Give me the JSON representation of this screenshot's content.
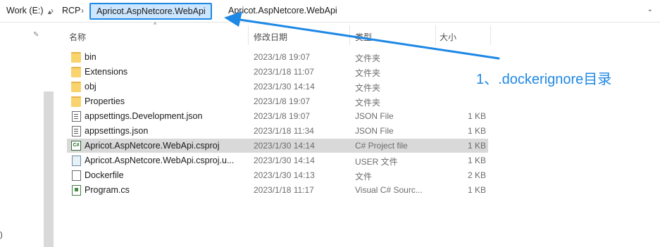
{
  "breadcrumb": {
    "items": [
      "Work (E:)",
      "RCP",
      "Apricot.AspNetcore.WebApi",
      "Apricot.AspNetcore.WebApi"
    ]
  },
  "columns": {
    "name": "名称",
    "date": "修改日期",
    "type": "类型",
    "size": "大小"
  },
  "files": [
    {
      "name": "bin",
      "date": "2023/1/8 19:07",
      "type": "文件夹",
      "size": "",
      "icon": "folder-icon"
    },
    {
      "name": "Extensions",
      "date": "2023/1/18 11:07",
      "type": "文件夹",
      "size": "",
      "icon": "folder-icon"
    },
    {
      "name": "obj",
      "date": "2023/1/30 14:14",
      "type": "文件夹",
      "size": "",
      "icon": "folder-icon"
    },
    {
      "name": "Properties",
      "date": "2023/1/8 19:07",
      "type": "文件夹",
      "size": "",
      "icon": "folder-icon"
    },
    {
      "name": "appsettings.Development.json",
      "date": "2023/1/8 19:07",
      "type": "JSON File",
      "size": "1 KB",
      "icon": "json-file-icon"
    },
    {
      "name": "appsettings.json",
      "date": "2023/1/18 11:34",
      "type": "JSON File",
      "size": "1 KB",
      "icon": "json-file-icon"
    },
    {
      "name": "Apricot.AspNetcore.WebApi.csproj",
      "date": "2023/1/30 14:14",
      "type": "C# Project file",
      "size": "1 KB",
      "icon": "csproj-file-icon",
      "selected": true
    },
    {
      "name": "Apricot.AspNetcore.WebApi.csproj.u...",
      "date": "2023/1/30 14:14",
      "type": "USER 文件",
      "size": "1 KB",
      "icon": "user-file-icon"
    },
    {
      "name": "Dockerfile",
      "date": "2023/1/30 14:13",
      "type": "文件",
      "size": "2 KB",
      "icon": "file-icon"
    },
    {
      "name": "Program.cs",
      "date": "2023/1/18 11:17",
      "type": "Visual C# Sourc...",
      "size": "1 KB",
      "icon": "cs-file-icon"
    }
  ],
  "annotation": {
    "text": "1、.dockerignore目录",
    "color": "#1e88e5"
  },
  "csproj_icon_glyph": "C#",
  "nav": {
    "edge_char": ")"
  }
}
